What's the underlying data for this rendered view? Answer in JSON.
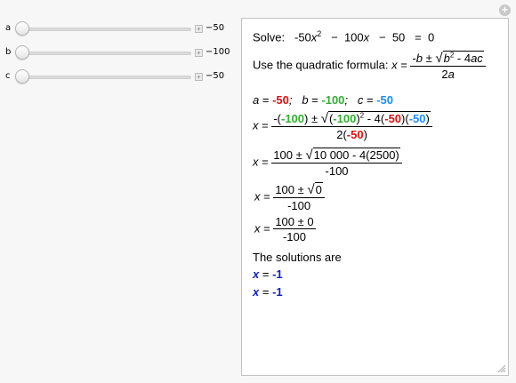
{
  "sliders": [
    {
      "label": "a",
      "value": "−50",
      "fraction": 0
    },
    {
      "label": "b",
      "value": "−100",
      "fraction": 0
    },
    {
      "label": "c",
      "value": "−50",
      "fraction": 0
    }
  ],
  "equation": {
    "solve_label": "Solve:",
    "a_term": "-50",
    "b_term": "100",
    "c_term": "50",
    "rhs": "0"
  },
  "formula": {
    "intro": "Use the quadratic formula:"
  },
  "coeffs": {
    "a": "-50",
    "b": "-100",
    "c": "-50"
  },
  "step1": {
    "neg_b": "-100",
    "b_sq": "-100",
    "a": "-50",
    "c": "-50",
    "two_a": "-50"
  },
  "step2": {
    "numer": "100 ±",
    "radicand": "10 000 - 4(2500)",
    "denom": "-100"
  },
  "step3": {
    "numer": "100 ±",
    "radicand": "0",
    "denom": "-100"
  },
  "step4": {
    "numer": "100 ± 0",
    "denom": "-100"
  },
  "solutions_label": "The solutions are",
  "solutions": [
    "-1",
    "-1"
  ],
  "colors": {
    "a": "#e01010",
    "b": "#30b030",
    "c": "#1a8cff",
    "solution": "#1020c8"
  }
}
